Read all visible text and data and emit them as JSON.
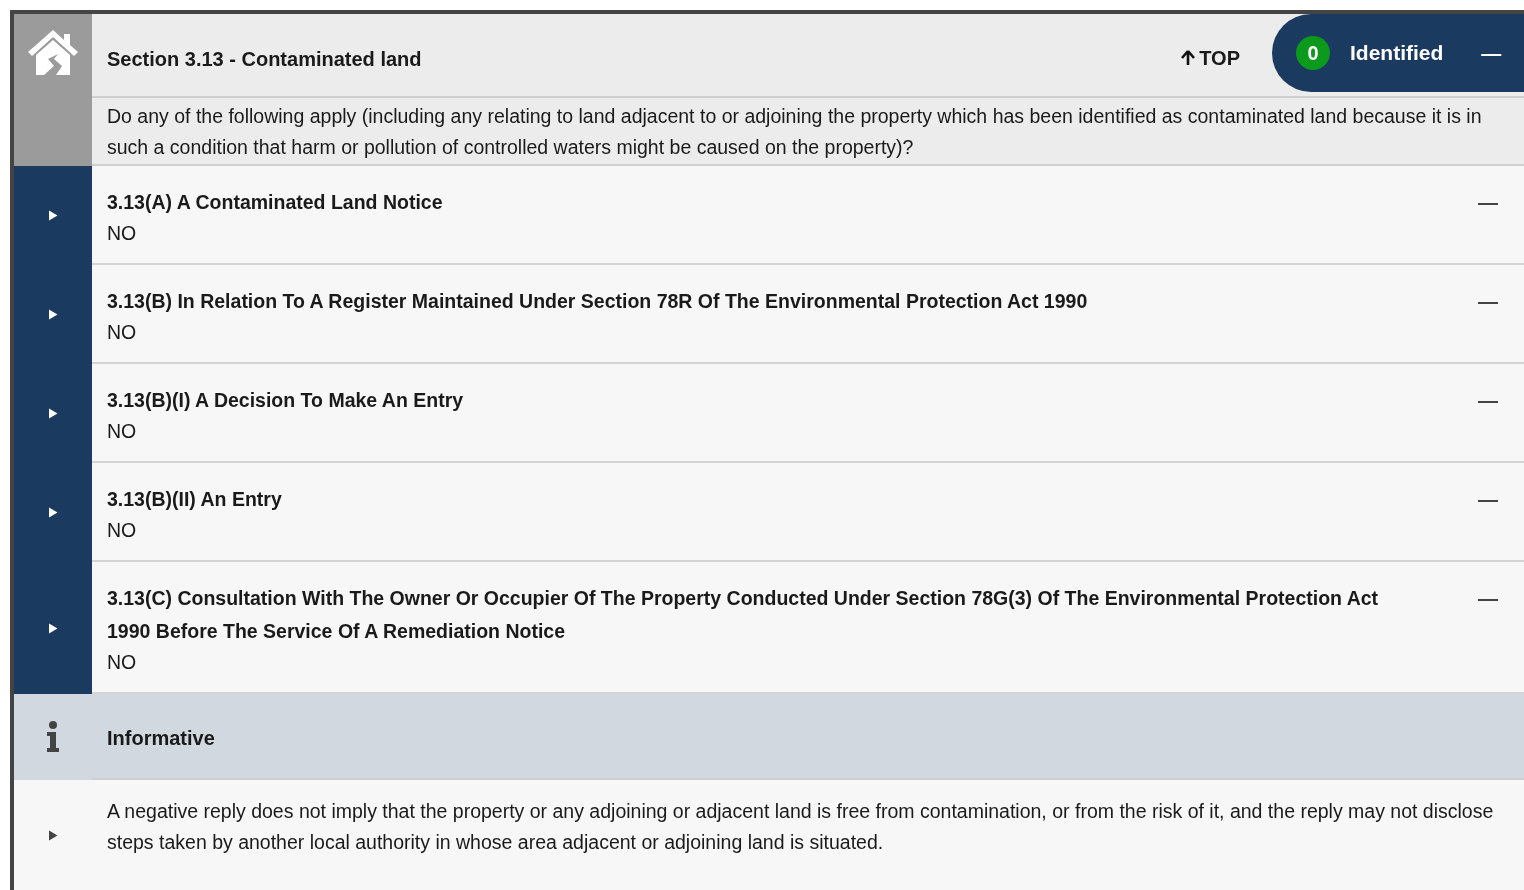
{
  "section": {
    "title": "Section 3.13 - Contaminated land",
    "top_link": "TOP",
    "count": "0",
    "status": "Identified",
    "collapse": "—",
    "question": "Do any of the following apply (including any relating to land adjacent to or adjoining the property which has been identified as contaminated land because it is in such a condition that harm or pollution of controlled waters might be caused on the property)?"
  },
  "items": [
    {
      "title": "3.13(A) A Contaminated Land Notice",
      "answer": "NO",
      "collapse": "—"
    },
    {
      "title": "3.13(B) In Relation To A Register Maintained Under Section 78R Of The Environmental Protection Act 1990",
      "answer": "NO",
      "collapse": "—"
    },
    {
      "title": "3.13(B)(I) A Decision To Make An Entry",
      "answer": "NO",
      "collapse": "—"
    },
    {
      "title": "3.13(B)(II) An Entry",
      "answer": "NO",
      "collapse": "—"
    },
    {
      "title": "3.13(C) Consultation With The Owner Or Occupier Of The Property Conducted Under Section 78G(3) Of The Environmental Protection Act 1990 Before The Service Of A Remediation Notice",
      "answer": "NO",
      "collapse": "—"
    }
  ],
  "informative": {
    "title": "Informative",
    "text": "A negative reply does not imply that the property or any adjoining or adjacent land is free from contamination, or from the risk of it, and the reply may not disclose steps taken by another local authority in whose area adjacent or adjoining land is situated."
  }
}
